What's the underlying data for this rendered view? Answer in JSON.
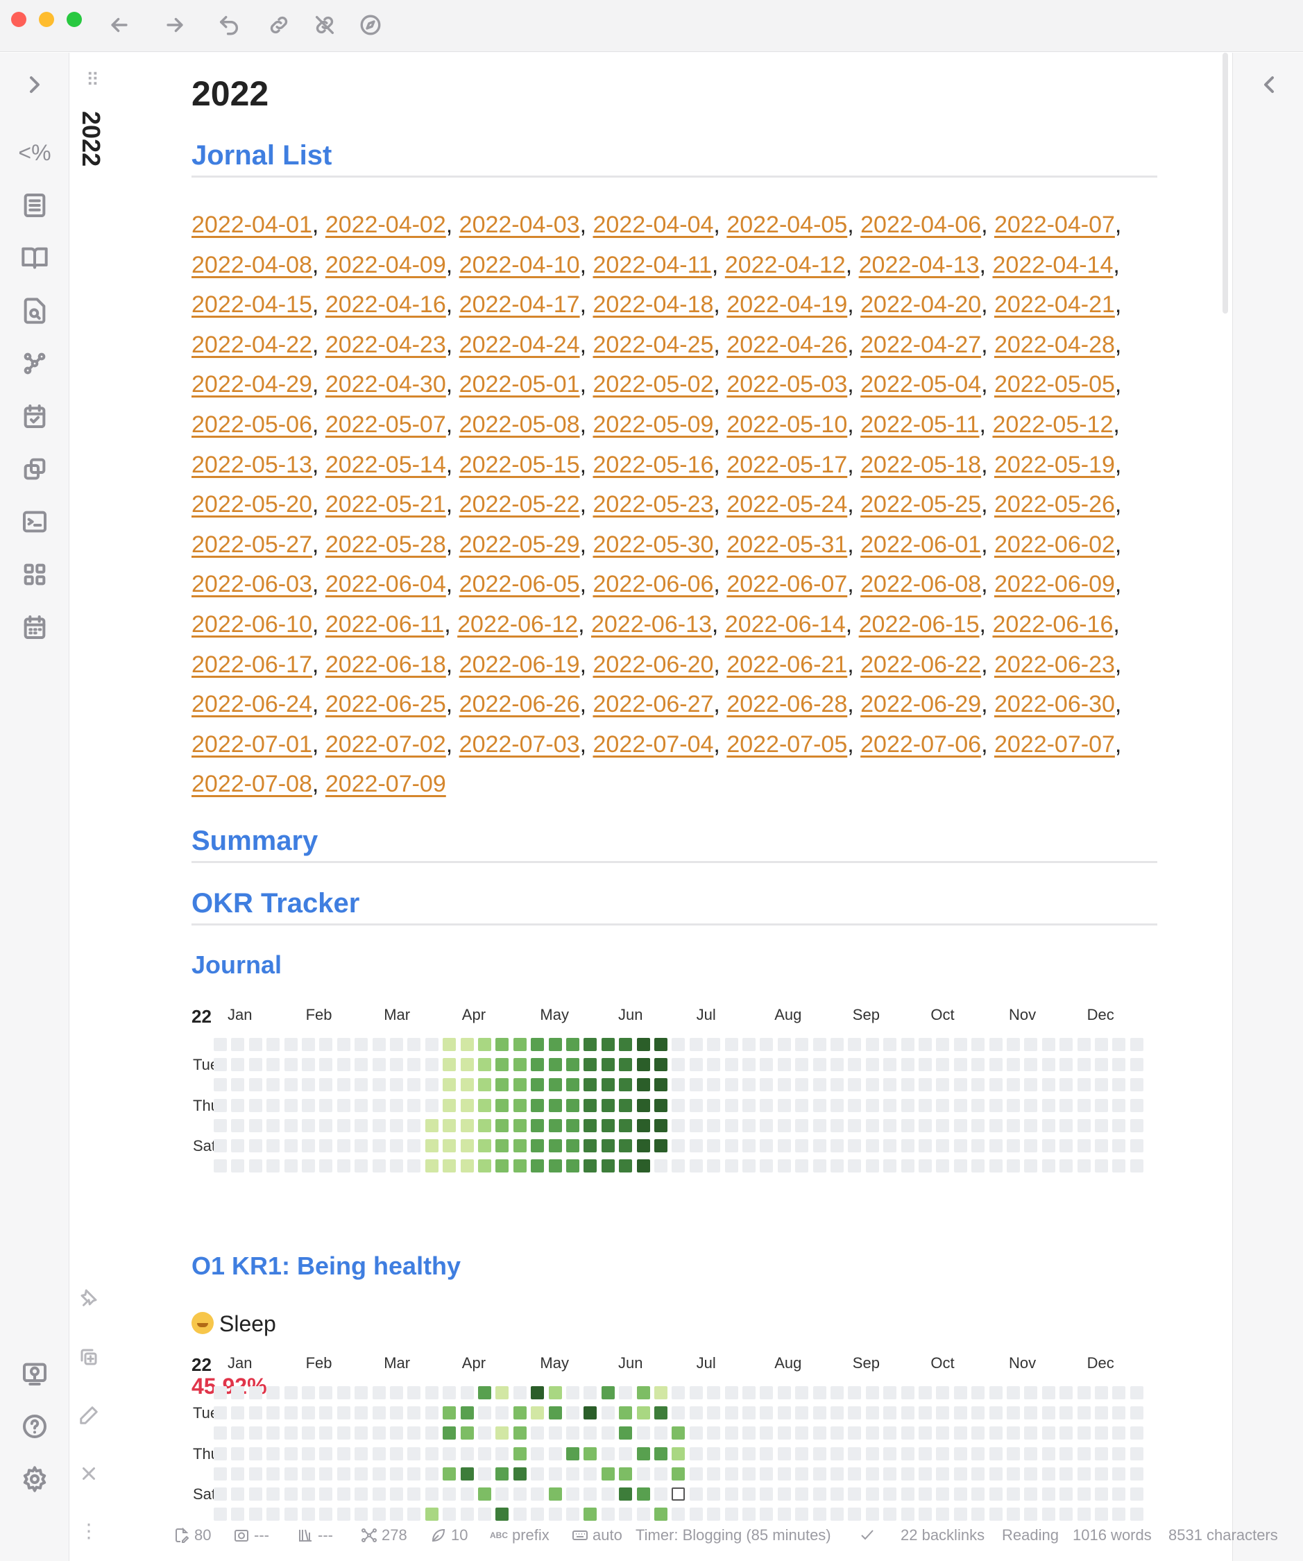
{
  "window": {
    "nav_buttons": [
      "back-arrow-icon",
      "forward-arrow-icon",
      "undo-icon",
      "link-icon",
      "unlink-icon",
      "compass-icon"
    ]
  },
  "ribbon": {
    "items": [
      "expand-sidebar-icon",
      "templater-icon",
      "list-icon",
      "book-icon",
      "file-search-icon",
      "graph-icon",
      "calendar-check-icon",
      "copy-icon",
      "terminal-icon",
      "grid-icon",
      "calendar-icon"
    ],
    "templater_text": "<%",
    "bottom": [
      "vault-icon",
      "help-icon",
      "settings-icon"
    ]
  },
  "tab": {
    "title": "2022",
    "actions": [
      "pin-icon",
      "new-note-icon",
      "edit-icon",
      "close-icon",
      "more-icon"
    ]
  },
  "note": {
    "title": "2022",
    "sections": {
      "journal_list": "Jornal List",
      "summary": "Summary",
      "okr": "OKR Tracker",
      "journal": "Journal",
      "kr1": "O1 KR1: Being healthy",
      "sleep": "Sleep",
      "sleep_percent": "45.92%"
    },
    "journal_dates": [
      "2022-04-01",
      "2022-04-02",
      "2022-04-03",
      "2022-04-04",
      "2022-04-05",
      "2022-04-06",
      "2022-04-07",
      "2022-04-08",
      "2022-04-09",
      "2022-04-10",
      "2022-04-11",
      "2022-04-12",
      "2022-04-13",
      "2022-04-14",
      "2022-04-15",
      "2022-04-16",
      "2022-04-17",
      "2022-04-18",
      "2022-04-19",
      "2022-04-20",
      "2022-04-21",
      "2022-04-22",
      "2022-04-23",
      "2022-04-24",
      "2022-04-25",
      "2022-04-26",
      "2022-04-27",
      "2022-04-28",
      "2022-04-29",
      "2022-04-30",
      "2022-05-01",
      "2022-05-02",
      "2022-05-03",
      "2022-05-04",
      "2022-05-05",
      "2022-05-06",
      "2022-05-07",
      "2022-05-08",
      "2022-05-09",
      "2022-05-10",
      "2022-05-11",
      "2022-05-12",
      "2022-05-13",
      "2022-05-14",
      "2022-05-15",
      "2022-05-16",
      "2022-05-17",
      "2022-05-18",
      "2022-05-19",
      "2022-05-20",
      "2022-05-21",
      "2022-05-22",
      "2022-05-23",
      "2022-05-24",
      "2022-05-25",
      "2022-05-26",
      "2022-05-27",
      "2022-05-28",
      "2022-05-29",
      "2022-05-30",
      "2022-05-31",
      "2022-06-01",
      "2022-06-02",
      "2022-06-03",
      "2022-06-04",
      "2022-06-05",
      "2022-06-06",
      "2022-06-07",
      "2022-06-08",
      "2022-06-09",
      "2022-06-10",
      "2022-06-11",
      "2022-06-12",
      "2022-06-13",
      "2022-06-14",
      "2022-06-15",
      "2022-06-16",
      "2022-06-17",
      "2022-06-18",
      "2022-06-19",
      "2022-06-20",
      "2022-06-21",
      "2022-06-22",
      "2022-06-23",
      "2022-06-24",
      "2022-06-25",
      "2022-06-26",
      "2022-06-27",
      "2022-06-28",
      "2022-06-29",
      "2022-06-30",
      "2022-07-01",
      "2022-07-02",
      "2022-07-03",
      "2022-07-04",
      "2022-07-05",
      "2022-07-06",
      "2022-07-07",
      "2022-07-08",
      "2022-07-09"
    ]
  },
  "heatmap": {
    "year_label": "22",
    "months": [
      "Jan",
      "Feb",
      "Mar",
      "Apr",
      "May",
      "Jun",
      "Jul",
      "Aug",
      "Sep",
      "Oct",
      "Nov",
      "Dec"
    ],
    "day_labels": [
      "Tue",
      "Thu",
      "Sat"
    ],
    "colors": {
      "empty": "#ebedf0",
      "l1": "#d2e7a4",
      "l2": "#a9d782",
      "l3": "#7dbd64",
      "l4": "#58a04f",
      "l5": "#3d7d3a",
      "l6": "#2b5e29"
    },
    "journal_levels": [
      [
        0,
        0,
        0,
        0,
        0,
        0,
        0,
        0,
        0,
        0,
        0,
        0,
        0,
        1,
        1,
        2,
        3,
        3,
        4,
        4,
        4,
        5,
        5,
        5,
        6,
        6,
        0,
        0,
        0,
        0,
        0,
        0,
        0,
        0,
        0,
        0,
        0,
        0,
        0,
        0,
        0,
        0,
        0,
        0,
        0,
        0,
        0,
        0,
        0,
        0,
        0,
        0,
        0
      ],
      [
        0,
        0,
        0,
        0,
        0,
        0,
        0,
        0,
        0,
        0,
        0,
        0,
        0,
        1,
        1,
        2,
        3,
        3,
        4,
        4,
        4,
        5,
        5,
        5,
        6,
        6,
        0,
        0,
        0,
        0,
        0,
        0,
        0,
        0,
        0,
        0,
        0,
        0,
        0,
        0,
        0,
        0,
        0,
        0,
        0,
        0,
        0,
        0,
        0,
        0,
        0,
        0,
        0
      ],
      [
        0,
        0,
        0,
        0,
        0,
        0,
        0,
        0,
        0,
        0,
        0,
        0,
        0,
        1,
        1,
        2,
        3,
        3,
        4,
        4,
        4,
        5,
        5,
        5,
        6,
        6,
        0,
        0,
        0,
        0,
        0,
        0,
        0,
        0,
        0,
        0,
        0,
        0,
        0,
        0,
        0,
        0,
        0,
        0,
        0,
        0,
        0,
        0,
        0,
        0,
        0,
        0,
        0
      ],
      [
        0,
        0,
        0,
        0,
        0,
        0,
        0,
        0,
        0,
        0,
        0,
        0,
        0,
        1,
        1,
        2,
        3,
        3,
        4,
        4,
        4,
        5,
        5,
        5,
        6,
        6,
        0,
        0,
        0,
        0,
        0,
        0,
        0,
        0,
        0,
        0,
        0,
        0,
        0,
        0,
        0,
        0,
        0,
        0,
        0,
        0,
        0,
        0,
        0,
        0,
        0,
        0,
        0
      ],
      [
        0,
        0,
        0,
        0,
        0,
        0,
        0,
        0,
        0,
        0,
        0,
        0,
        1,
        1,
        1,
        2,
        3,
        3,
        4,
        4,
        4,
        5,
        5,
        5,
        6,
        6,
        0,
        0,
        0,
        0,
        0,
        0,
        0,
        0,
        0,
        0,
        0,
        0,
        0,
        0,
        0,
        0,
        0,
        0,
        0,
        0,
        0,
        0,
        0,
        0,
        0,
        0,
        0
      ],
      [
        0,
        0,
        0,
        0,
        0,
        0,
        0,
        0,
        0,
        0,
        0,
        0,
        1,
        1,
        1,
        2,
        3,
        3,
        4,
        4,
        4,
        5,
        5,
        5,
        6,
        6,
        0,
        0,
        0,
        0,
        0,
        0,
        0,
        0,
        0,
        0,
        0,
        0,
        0,
        0,
        0,
        0,
        0,
        0,
        0,
        0,
        0,
        0,
        0,
        0,
        0,
        0,
        0
      ],
      [
        0,
        0,
        0,
        0,
        0,
        0,
        0,
        0,
        0,
        0,
        0,
        0,
        1,
        1,
        1,
        2,
        3,
        3,
        4,
        4,
        4,
        5,
        5,
        5,
        6,
        0,
        0,
        0,
        0,
        0,
        0,
        0,
        0,
        0,
        0,
        0,
        0,
        0,
        0,
        0,
        0,
        0,
        0,
        0,
        0,
        0,
        0,
        0,
        0,
        0,
        0,
        0,
        0
      ]
    ],
    "sleep_levels": [
      [
        0,
        0,
        0,
        0,
        0,
        0,
        0,
        0,
        0,
        0,
        0,
        0,
        0,
        0,
        0,
        4,
        1,
        0,
        6,
        2,
        0,
        0,
        4,
        0,
        3,
        1,
        0,
        0,
        0,
        0,
        0,
        0,
        0,
        0,
        0,
        0,
        0,
        0,
        0,
        0,
        0,
        0,
        0,
        0,
        0,
        0,
        0,
        0,
        0,
        0,
        0,
        0,
        0
      ],
      [
        0,
        0,
        0,
        0,
        0,
        0,
        0,
        0,
        0,
        0,
        0,
        0,
        0,
        3,
        4,
        0,
        0,
        3,
        1,
        4,
        0,
        6,
        0,
        3,
        2,
        5,
        0,
        0,
        0,
        0,
        0,
        0,
        0,
        0,
        0,
        0,
        0,
        0,
        0,
        0,
        0,
        0,
        0,
        0,
        0,
        0,
        0,
        0,
        0,
        0,
        0,
        0,
        0
      ],
      [
        0,
        0,
        0,
        0,
        0,
        0,
        0,
        0,
        0,
        0,
        0,
        0,
        0,
        4,
        3,
        0,
        1,
        3,
        0,
        0,
        0,
        0,
        0,
        4,
        0,
        0,
        3,
        0,
        0,
        0,
        0,
        0,
        0,
        0,
        0,
        0,
        0,
        0,
        0,
        0,
        0,
        0,
        0,
        0,
        0,
        0,
        0,
        0,
        0,
        0,
        0,
        0,
        0
      ],
      [
        0,
        0,
        0,
        0,
        0,
        0,
        0,
        0,
        0,
        0,
        0,
        0,
        0,
        0,
        0,
        0,
        0,
        3,
        0,
        0,
        4,
        3,
        0,
        0,
        4,
        4,
        2,
        0,
        0,
        0,
        0,
        0,
        0,
        0,
        0,
        0,
        0,
        0,
        0,
        0,
        0,
        0,
        0,
        0,
        0,
        0,
        0,
        0,
        0,
        0,
        0,
        0,
        0
      ],
      [
        0,
        0,
        0,
        0,
        0,
        0,
        0,
        0,
        0,
        0,
        0,
        0,
        0,
        3,
        5,
        0,
        4,
        5,
        0,
        0,
        0,
        0,
        3,
        3,
        0,
        0,
        3,
        0,
        0,
        0,
        0,
        0,
        0,
        0,
        0,
        0,
        0,
        0,
        0,
        0,
        0,
        0,
        0,
        0,
        0,
        0,
        0,
        0,
        0,
        0,
        0,
        0,
        0
      ],
      [
        0,
        0,
        0,
        0,
        0,
        0,
        0,
        0,
        0,
        0,
        0,
        0,
        0,
        0,
        0,
        3,
        0,
        0,
        0,
        3,
        0,
        0,
        0,
        5,
        4,
        0,
        7,
        0,
        0,
        0,
        0,
        0,
        0,
        0,
        0,
        0,
        0,
        0,
        0,
        0,
        0,
        0,
        0,
        0,
        0,
        0,
        0,
        0,
        0,
        0,
        0,
        0,
        0
      ],
      [
        0,
        0,
        0,
        0,
        0,
        0,
        0,
        0,
        0,
        0,
        0,
        0,
        2,
        0,
        0,
        0,
        5,
        0,
        0,
        0,
        0,
        3,
        0,
        0,
        0,
        3,
        0,
        0,
        0,
        0,
        0,
        0,
        0,
        0,
        0,
        0,
        0,
        0,
        0,
        0,
        0,
        0,
        0,
        0,
        0,
        0,
        0,
        0,
        0,
        0,
        0,
        0,
        0
      ]
    ]
  },
  "status": {
    "backlinks_count": "80",
    "a2": "---",
    "a3": "---",
    "graph": "278",
    "a5": "10",
    "prefix": "prefix",
    "keyboard": "auto",
    "timer": "Timer: Blogging (85 minutes)",
    "backlinks": "22 backlinks",
    "mode": "Reading",
    "words": "1016 words",
    "chars": "8531 characters"
  }
}
